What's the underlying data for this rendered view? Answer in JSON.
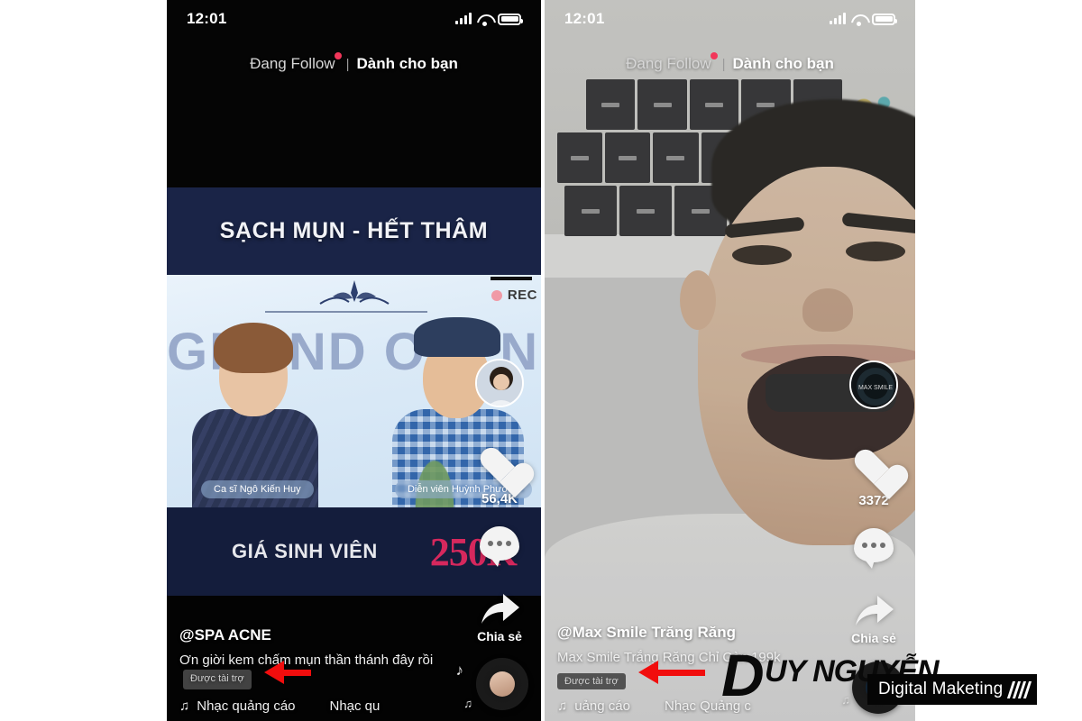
{
  "meta": {
    "background_color": "#ffffff",
    "accent_red": "#f10d0d",
    "navy": "#1a2447",
    "pink": "#d6285d"
  },
  "status_bar": {
    "time": "12:01",
    "signal_icon": "signal-bars-icon",
    "wifi_icon": "wifi-icon",
    "battery_icon": "battery-icon"
  },
  "tabs": {
    "following_label": "Đang Follow",
    "separator": "|",
    "foryou_label": "Dành cho bạn",
    "live_dot_color": "#f2365a"
  },
  "left_phone": {
    "banner_top": "SẠCH MỤN - HẾT THÂM",
    "video_overlay_text": "GRAND OPENING",
    "rec_label": "REC",
    "name_pill_left": "Ca sĩ Ngô Kiến Huy",
    "name_pill_right": "Diễn viên Huỳnh Phương",
    "banner_bottom_label": "GIÁ SINH VIÊN",
    "banner_bottom_price": "250K",
    "rail": {
      "like_count": "56,4K",
      "share_label": "Chia sẻ"
    },
    "caption": {
      "username": "@SPA ACNE",
      "description": "Ơn giời kem chấm mụn thần thánh đây rồi",
      "sponsored_badge": "Được tài trợ",
      "music_note_icon": "music-note-icon",
      "music_text": "Nhạc quảng cáo",
      "music_text_repeat": "Nhạc qu"
    }
  },
  "right_phone": {
    "rail": {
      "like_count": "3372",
      "share_label": "Chia sẻ"
    },
    "caption": {
      "username": "@Max Smile Trăng Răng",
      "description": "Max Smile Trắng Răng Chỉ Còn 199k",
      "sponsored_badge": "Được tài trợ",
      "music_note_icon": "music-note-icon",
      "music_text": "uảng cáo",
      "music_text_repeat": "Nhạc Quảng c"
    }
  },
  "watermark": {
    "letter_d": "D",
    "brand": "UY NGUYỄN",
    "tagline": "Digital Maketing"
  }
}
